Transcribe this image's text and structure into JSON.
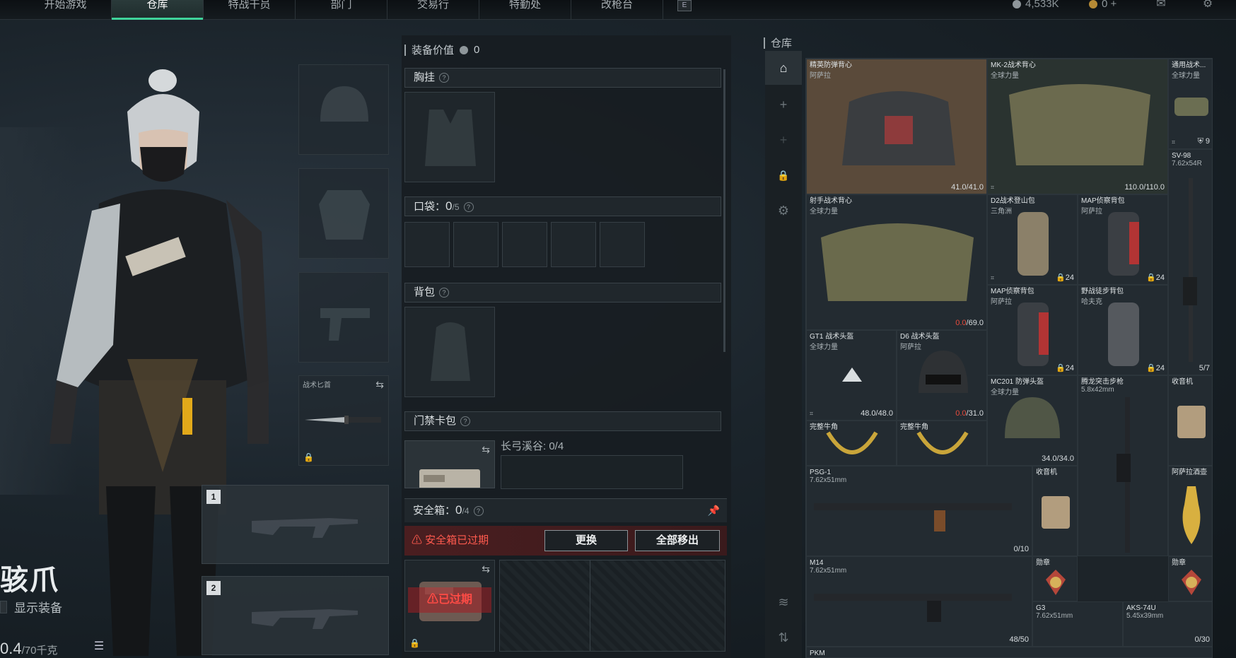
{
  "nav": {
    "tabs": [
      "开始游戏",
      "仓库",
      "特战干员",
      "部门",
      "交易行",
      "特勤处",
      "改枪台"
    ],
    "active_tab": "仓库",
    "hotkey": "E",
    "currency_1": "4,533K",
    "currency_2": "0 +"
  },
  "character": {
    "name": "骇爪",
    "show_equip_label": "显示装备",
    "weight_value": "0.4",
    "weight_max": "/70千克"
  },
  "equipment_column": {
    "melee_label": "战术匕首"
  },
  "weapon_slots": [
    "1",
    "2"
  ],
  "panel": {
    "value_label": "装备价值",
    "value": "0",
    "chest_rig": "胸挂",
    "pockets_label": "口袋：",
    "pockets_used": "0",
    "pockets_max": "/5",
    "backpack": "背包",
    "keycard_label": "门禁卡包",
    "keycard_area": "长弓溪谷: 0/4",
    "safebox_label": "安全箱：",
    "safebox_used": "0",
    "safebox_max": "/4",
    "safebox_expired": "安全箱已过期",
    "replace_btn": "更换",
    "move_all_btn": "全部移出",
    "expired_stamp": "已过期"
  },
  "warehouse": {
    "title": "仓库",
    "items": [
      {
        "name": "精英防弹背心",
        "sub": "阿萨拉",
        "dur": "41.0/41.0"
      },
      {
        "name": "MK-2战术背心",
        "sub": "全球力量",
        "dur": "110.0/110.0"
      },
      {
        "name": "通用战术...",
        "sub": "全球力量",
        "count": "9"
      },
      {
        "name": "SV-98",
        "sub": "7.62x54R",
        "count": "5/7"
      },
      {
        "name": "射手战术背心",
        "sub": "全球力量",
        "dur_red": "0.0",
        "dur_max": "/69.0"
      },
      {
        "name": "D2战术登山包",
        "sub": "三角洲",
        "count": "24"
      },
      {
        "name": "MAP侦察背包",
        "sub": "阿萨拉",
        "count": "24"
      },
      {
        "name": "MAP侦察背包",
        "sub": "阿萨拉",
        "count": "24"
      },
      {
        "name": "野战徒步背包",
        "sub": "哈夫克",
        "count": "24"
      },
      {
        "name": "GT1 战术头盔",
        "sub": "全球力量",
        "dur": "48.0/48.0"
      },
      {
        "name": "D6 战术头盔",
        "sub": "阿萨拉",
        "dur_red": "0.0",
        "dur_max": "/31.0"
      },
      {
        "name": "MC201 防弹头盔",
        "sub": "全球力量",
        "dur": "34.0/34.0"
      },
      {
        "name": "腾龙突击步枪",
        "sub": "5.8x42mm"
      },
      {
        "name": "收音机",
        "sub": ""
      },
      {
        "name": "完整牛角",
        "sub": ""
      },
      {
        "name": "完整牛角",
        "sub": ""
      },
      {
        "name": "PSG-1",
        "sub": "7.62x51mm",
        "count": "0/10"
      },
      {
        "name": "收音机",
        "sub": ""
      },
      {
        "name": "阿萨拉酒壶",
        "sub": ""
      },
      {
        "name": "M14",
        "sub": "7.62x51mm",
        "count": "48/50"
      },
      {
        "name": "勋章",
        "sub": ""
      },
      {
        "name": "勋章",
        "sub": ""
      },
      {
        "name": "G3",
        "sub": "7.62x51mm"
      },
      {
        "name": "AKS-74U",
        "sub": "5.45x39mm",
        "count": "0/30"
      },
      {
        "name": "PKM",
        "sub": ""
      }
    ]
  },
  "colors": {
    "accent": "#3fd39a",
    "danger": "#e64a3c",
    "expired_bg": "#4a1e20"
  }
}
